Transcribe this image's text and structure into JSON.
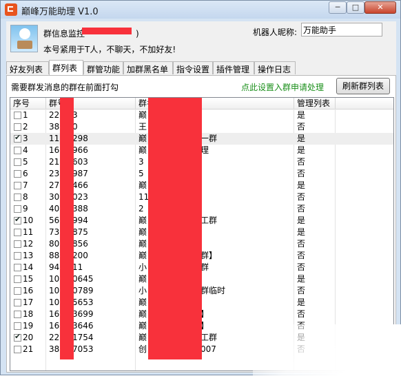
{
  "window": {
    "title": "巅峰万能助理 V1.0",
    "minimize_glyph": "─",
    "maximize_glyph": "□",
    "close_glyph": "✕"
  },
  "header": {
    "group_info_label": "群信息监控",
    "group_info_suffix": ")",
    "notice": "本号紧用于T人，不聊天，不加好友!",
    "nickname_label": "机器人昵称:",
    "nickname_value": "万能助手"
  },
  "tabs": [
    {
      "label": "好友列表",
      "active": false
    },
    {
      "label": "群列表",
      "active": true
    },
    {
      "label": "群管功能",
      "active": false
    },
    {
      "label": "加群黑名单",
      "active": false
    },
    {
      "label": "指令设置",
      "active": false
    },
    {
      "label": "插件管理",
      "active": false
    },
    {
      "label": "操作日志",
      "active": false
    }
  ],
  "panel": {
    "hint": "需要群发消息的群在前面打勾",
    "join_link": "点此设置入群申请处理",
    "refresh_button": "刷新群列表"
  },
  "table": {
    "columns": [
      "序号",
      "群号",
      "群名",
      "管理列表"
    ],
    "rows": [
      {
        "checked": false,
        "no": "1",
        "group_id": "22",
        "group_id_tail": "3",
        "name": "巅",
        "name_tail": "",
        "admin": "是"
      },
      {
        "checked": false,
        "no": "2",
        "group_id": "38",
        "group_id_tail": "0",
        "name": "王",
        "name_tail": "",
        "admin": "否"
      },
      {
        "checked": true,
        "no": "3",
        "group_id": "11",
        "group_id_tail": "298",
        "name": "巅",
        "name_tail": "一群",
        "admin": "是"
      },
      {
        "checked": false,
        "no": "4",
        "group_id": "16",
        "group_id_tail": "966",
        "name": "巅",
        "name_tail": "理",
        "admin": "是"
      },
      {
        "checked": false,
        "no": "5",
        "group_id": "21",
        "group_id_tail": "603",
        "name": "3",
        "name_tail": "",
        "admin": "否"
      },
      {
        "checked": false,
        "no": "6",
        "group_id": "23",
        "group_id_tail": "987",
        "name": "5",
        "name_tail": "",
        "admin": "否"
      },
      {
        "checked": false,
        "no": "7",
        "group_id": "27",
        "group_id_tail": "466",
        "name": "巅",
        "name_tail": "",
        "admin": "是"
      },
      {
        "checked": false,
        "no": "8",
        "group_id": "30",
        "group_id_tail": "023",
        "name": "11",
        "name_tail": "",
        "admin": "否"
      },
      {
        "checked": false,
        "no": "9",
        "group_id": "40",
        "group_id_tail": "388",
        "name": "2",
        "name_tail": "",
        "admin": "否"
      },
      {
        "checked": true,
        "no": "10",
        "group_id": "56",
        "group_id_tail": "994",
        "name": "巅",
        "name_tail": "工群",
        "admin": "是"
      },
      {
        "checked": false,
        "no": "11",
        "group_id": "73",
        "group_id_tail": "875",
        "name": "巅",
        "name_tail": "",
        "admin": "是"
      },
      {
        "checked": false,
        "no": "12",
        "group_id": "80",
        "group_id_tail": "856",
        "name": "巅",
        "name_tail": "",
        "admin": "否"
      },
      {
        "checked": false,
        "no": "13",
        "group_id": "88",
        "group_id_tail": "200",
        "name": "巅",
        "name_tail": "群】",
        "admin": "否"
      },
      {
        "checked": false,
        "no": "14",
        "group_id": "94",
        "group_id_tail": "11",
        "name": "小",
        "name_tail": "群",
        "admin": "否"
      },
      {
        "checked": false,
        "no": "15",
        "group_id": "10",
        "group_id_tail": "0645",
        "name": "巅",
        "name_tail": "",
        "admin": "是"
      },
      {
        "checked": false,
        "no": "16",
        "group_id": "10",
        "group_id_tail": "0789",
        "name": "小",
        "name_tail": "群临时",
        "admin": "否"
      },
      {
        "checked": false,
        "no": "17",
        "group_id": "10",
        "group_id_tail": "5653",
        "name": "巅",
        "name_tail": "",
        "admin": "是"
      },
      {
        "checked": false,
        "no": "18",
        "group_id": "16",
        "group_id_tail": "3699",
        "name": "巅",
        "name_tail": "】",
        "admin": "否"
      },
      {
        "checked": false,
        "no": "19",
        "group_id": "16",
        "group_id_tail": "3646",
        "name": "巅",
        "name_tail": "】",
        "admin": "否"
      },
      {
        "checked": true,
        "no": "20",
        "group_id": "22",
        "group_id_tail": "1754",
        "name": "巅",
        "name_tail": "工群",
        "admin": "是"
      },
      {
        "checked": false,
        "no": "21",
        "group_id": "38",
        "group_id_tail": "7053",
        "name": "创",
        "name_tail": "007",
        "admin": "否"
      }
    ]
  },
  "colors": {
    "redaction": "#f8313b",
    "link_green": "#1a8f1a",
    "title_bar": "#c4d7ee"
  }
}
